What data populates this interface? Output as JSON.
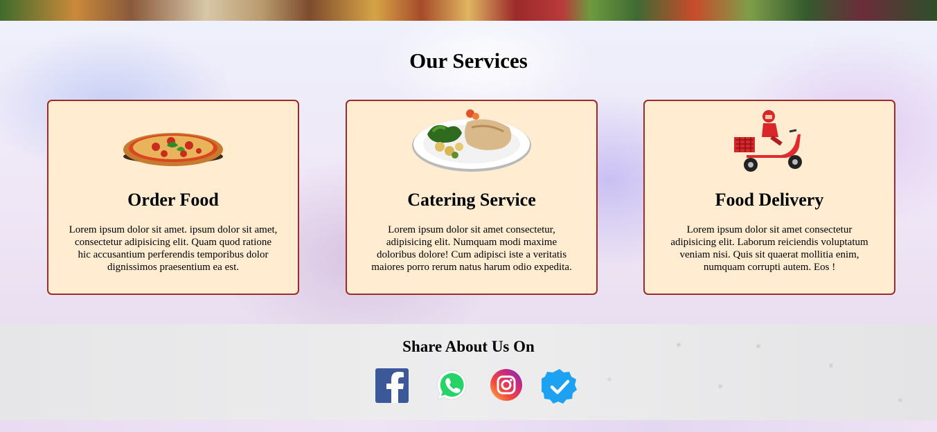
{
  "services": {
    "title": "Our Services",
    "cards": [
      {
        "image": "pizza",
        "title": "Order Food",
        "text": "Lorem ipsum dolor sit amet. ipsum dolor sit amet, consectetur adipisicing elit. Quam quod ratione hic accusantium perferendis temporibus dolor dignissimos praesentium ea est."
      },
      {
        "image": "catering-plate",
        "title": "Catering Service",
        "text": "Lorem ipsum dolor sit amet consectetur, adipisicing elit. Numquam modi maxime doloribus dolore! Cum adipisci iste a veritatis maiores porro rerum natus harum odio expedita."
      },
      {
        "image": "delivery-scooter",
        "title": "Food Delivery",
        "text": "Lorem ipsum dolor sit amet consectetur adipisicing elit. Laborum reiciendis voluptatum veniam nisi. Quis sit quaerat mollitia enim, numquam corrupti autem. Eos !"
      }
    ]
  },
  "share": {
    "title": "Share About Us On",
    "icons": [
      "facebook-icon",
      "whatsapp-icon",
      "instagram-icon",
      "verified-icon"
    ]
  },
  "colors": {
    "card_background": "#ffecd1",
    "card_border": "#9b2b2b",
    "facebook": "#3b5998",
    "whatsapp": "#25d366",
    "verified": "#1da1f2"
  }
}
